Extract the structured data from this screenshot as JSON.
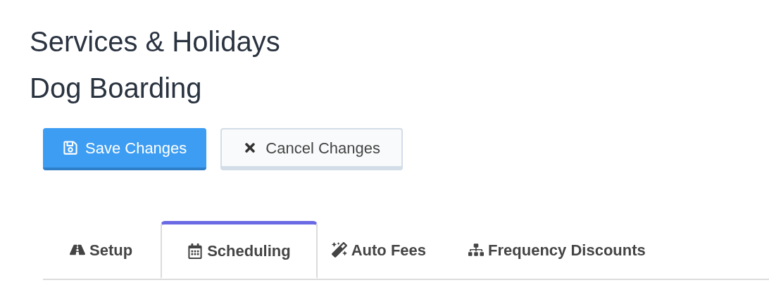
{
  "titles": [
    "Services & Holidays",
    "Dog Boarding"
  ],
  "buttons": [
    {
      "label": "Save Changes",
      "kind": "primary"
    },
    {
      "label": "Cancel Changes",
      "kind": "secondary"
    }
  ],
  "tabs": [
    {
      "label": "Setup",
      "kind": "road",
      "selected": false
    },
    {
      "label": "Scheduling",
      "kind": "calendar",
      "selected": true
    },
    {
      "label": "Auto Fees",
      "kind": "wand",
      "selected": false
    },
    {
      "label": "Frequency Discounts",
      "kind": "sitemap",
      "selected": false
    }
  ]
}
